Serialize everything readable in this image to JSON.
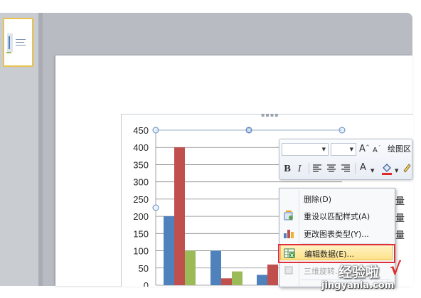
{
  "chart_data": {
    "type": "bar",
    "yticks": [
      "0",
      "50",
      "100",
      "150",
      "200",
      "250",
      "300",
      "350",
      "400",
      "450"
    ],
    "ylim": [
      0,
      450
    ],
    "grid": true,
    "categories": [
      "",
      "",
      ""
    ],
    "series": [
      {
        "color": "#4f81bd",
        "values": [
          200,
          100,
          30
        ]
      },
      {
        "color": "#c0504d",
        "values": [
          400,
          20,
          60
        ]
      },
      {
        "color": "#9bbb59",
        "values": [
          100,
          40,
          0
        ]
      }
    ]
  },
  "mini_toolbar": {
    "grow_font": "A",
    "shrink_font": "A",
    "area_label": "绘图区",
    "bold": "B",
    "italic": "I",
    "font_color": "A"
  },
  "context_menu": {
    "items": [
      {
        "label": "删除(D)",
        "icon": "delete-blank"
      },
      {
        "label": "重设以匹配样式(A)",
        "icon": "reset-style-icon"
      },
      {
        "label": "更改图表类型(Y)...",
        "icon": "chart-type-icon"
      },
      {
        "label": "编辑数据(E)...",
        "icon": "edit-data-icon"
      },
      {
        "label": "三维旋转...",
        "icon": "3d-rotate-icon"
      }
    ]
  },
  "behind_labels": [
    "量",
    "量",
    "量"
  ],
  "watermark": {
    "top": "经验啦",
    "check": "√",
    "bottom": "jingyanla.com"
  },
  "colors": {
    "highlight": "#fde28a",
    "callout": "#e0303a"
  }
}
